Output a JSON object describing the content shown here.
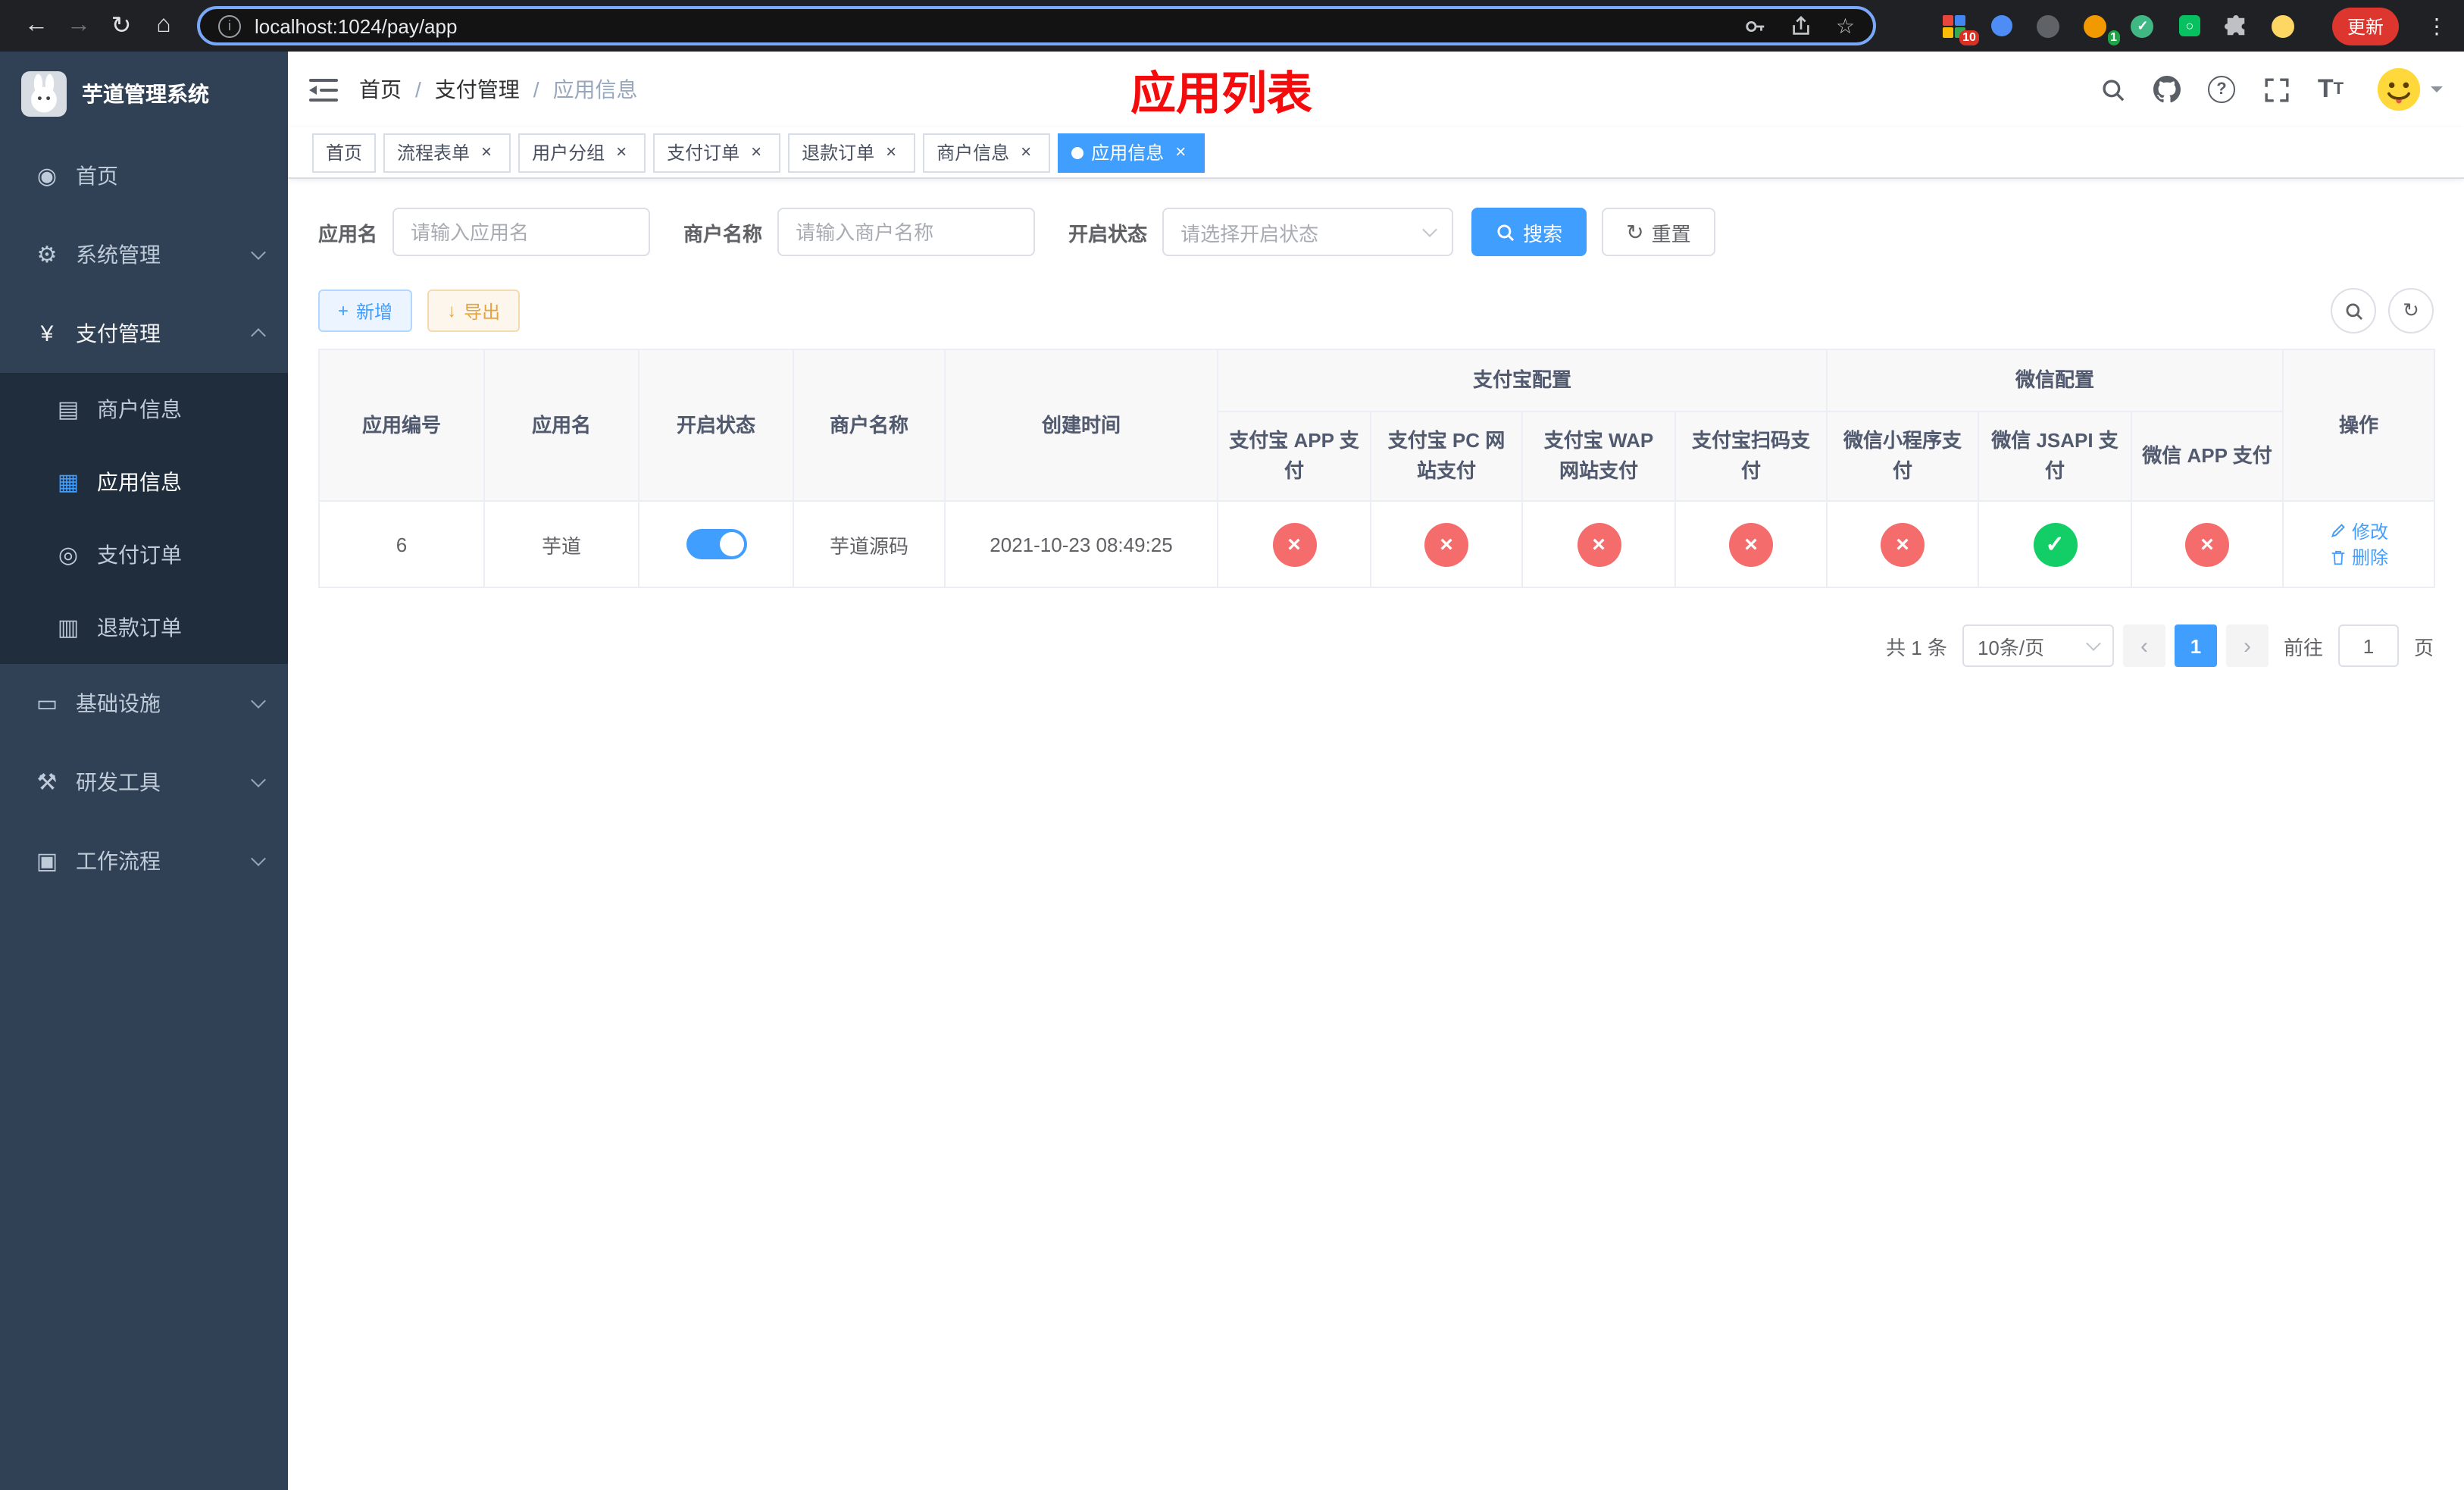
{
  "colors": {
    "primary": "#409EFF",
    "success": "#13ce66",
    "danger": "#f56c6c",
    "warning": "#e6a23c"
  },
  "browser": {
    "url": "localhost:1024/pay/app",
    "update_button": "更新",
    "extensions_badge_count": "10",
    "profile_badge_count": "1"
  },
  "sidebar": {
    "logo_title": "芋道管理系统",
    "menu": [
      {
        "glyph": "◉",
        "label": "首页"
      },
      {
        "glyph": "⚙",
        "label": "系统管理"
      },
      {
        "glyph": "¥",
        "label": "支付管理"
      },
      {
        "glyph": "▭",
        "label": "基础设施"
      },
      {
        "glyph": "⚒",
        "label": "研发工具"
      },
      {
        "glyph": "▣",
        "label": "工作流程"
      }
    ],
    "submenu": [
      {
        "glyph": "▤",
        "label": "商户信息"
      },
      {
        "glyph": "▦",
        "label": "应用信息"
      },
      {
        "glyph": "◎",
        "label": "支付订单"
      },
      {
        "glyph": "▥",
        "label": "退款订单"
      }
    ]
  },
  "navbar": {
    "breadcrumb": [
      "首页",
      "支付管理",
      "应用信息"
    ],
    "overlay_title": "应用列表"
  },
  "tabs": [
    {
      "label": "首页"
    },
    {
      "label": "流程表单"
    },
    {
      "label": "用户分组"
    },
    {
      "label": "支付订单"
    },
    {
      "label": "退款订单"
    },
    {
      "label": "商户信息"
    },
    {
      "label": "应用信息"
    }
  ],
  "filters": {
    "app_name_label": "应用名",
    "app_name_placeholder": "请输入应用名",
    "merchant_label": "商户名称",
    "merchant_placeholder": "请输入商户名称",
    "status_label": "开启状态",
    "status_placeholder": "请选择开启状态",
    "search_button": "搜索",
    "reset_button": "重置"
  },
  "toolbar": {
    "add_button": "新增",
    "export_button": "导出"
  },
  "table": {
    "columns": [
      "应用编号",
      "应用名",
      "开启状态",
      "商户名称",
      "创建时间"
    ],
    "groups": [
      {
        "label": "支付宝配置",
        "children": [
          "支付宝 APP 支付",
          "支付宝 PC 网站支付",
          "支付宝 WAP 网站支付",
          "支付宝扫码支付"
        ]
      },
      {
        "label": "微信配置",
        "children": [
          "微信小程序支付",
          "微信 JSAPI 支付",
          "微信 APP 支付"
        ]
      }
    ],
    "action_column": "操作",
    "rows": [
      {
        "id": "6",
        "name": "芋道",
        "enabled": true,
        "merchant": "芋道源码",
        "created": "2021-10-23 08:49:25",
        "statuses": [
          "no",
          "no",
          "no",
          "no",
          "no",
          "yes",
          "no"
        ],
        "edit_label": "修改",
        "delete_label": "删除"
      }
    ]
  },
  "pagination": {
    "total_text": "共 1 条",
    "page_size": "10条/页",
    "current_page": "1",
    "goto_label": "前往",
    "goto_value": "1",
    "goto_suffix": "页"
  }
}
